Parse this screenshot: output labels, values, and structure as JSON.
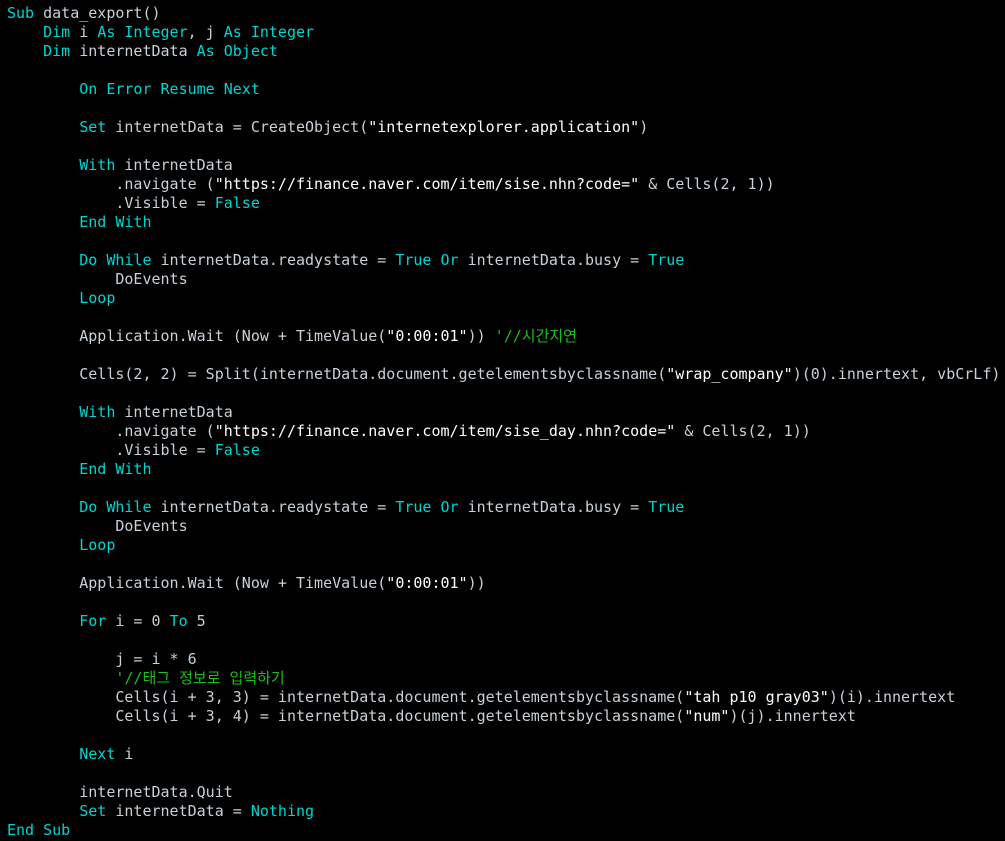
{
  "colors": {
    "background": "#000000",
    "keyword": "#00d4d4",
    "identifier": "#c8d0d8",
    "string": "#ffffff",
    "comment": "#19c019"
  },
  "lines": [
    [
      [
        "kw",
        "Sub "
      ],
      [
        "id",
        "data_export()"
      ]
    ],
    [
      [
        "kw",
        "    Dim "
      ],
      [
        "id",
        "i "
      ],
      [
        "kw",
        "As Integer"
      ],
      [
        "id",
        ", j "
      ],
      [
        "kw",
        "As Integer"
      ]
    ],
    [
      [
        "kw",
        "    Dim "
      ],
      [
        "id",
        "internetData "
      ],
      [
        "kw",
        "As Object"
      ]
    ],
    [],
    [
      [
        "kw",
        "        On Error Resume Next"
      ]
    ],
    [],
    [
      [
        "kw",
        "        Set "
      ],
      [
        "id",
        "internetData = CreateObject("
      ],
      [
        "str",
        "\"internetexplorer.application\""
      ],
      [
        "id",
        ")"
      ]
    ],
    [],
    [
      [
        "kw",
        "        With "
      ],
      [
        "id",
        "internetData"
      ]
    ],
    [
      [
        "id",
        "            .navigate ("
      ],
      [
        "str",
        "\"https://finance.naver.com/item/sise.nhn?code=\""
      ],
      [
        "id",
        " & Cells(2, 1))"
      ]
    ],
    [
      [
        "id",
        "            .Visible = "
      ],
      [
        "kw",
        "False"
      ]
    ],
    [
      [
        "kw",
        "        End With"
      ]
    ],
    [],
    [
      [
        "kw",
        "        Do While "
      ],
      [
        "id",
        "internetData.readystate = "
      ],
      [
        "kw",
        "True Or "
      ],
      [
        "id",
        "internetData.busy = "
      ],
      [
        "kw",
        "True"
      ]
    ],
    [
      [
        "id",
        "            DoEvents"
      ]
    ],
    [
      [
        "kw",
        "        Loop"
      ]
    ],
    [],
    [
      [
        "id",
        "        Application.Wait (Now + TimeValue("
      ],
      [
        "str",
        "\"0:00:01\""
      ],
      [
        "id",
        ")) "
      ],
      [
        "cm",
        "'//시간지연"
      ]
    ],
    [],
    [
      [
        "id",
        "        Cells(2, 2) = Split(internetData.document.getelementsbyclassname("
      ],
      [
        "str",
        "\"wrap_company\""
      ],
      [
        "id",
        ")(0).innertext, vbCrLf)"
      ]
    ],
    [],
    [
      [
        "kw",
        "        With "
      ],
      [
        "id",
        "internetData"
      ]
    ],
    [
      [
        "id",
        "            .navigate ("
      ],
      [
        "str",
        "\"https://finance.naver.com/item/sise_day.nhn?code=\""
      ],
      [
        "id",
        " & Cells(2, 1))"
      ]
    ],
    [
      [
        "id",
        "            .Visible = "
      ],
      [
        "kw",
        "False"
      ]
    ],
    [
      [
        "kw",
        "        End With"
      ]
    ],
    [],
    [
      [
        "kw",
        "        Do While "
      ],
      [
        "id",
        "internetData.readystate = "
      ],
      [
        "kw",
        "True Or "
      ],
      [
        "id",
        "internetData.busy = "
      ],
      [
        "kw",
        "True"
      ]
    ],
    [
      [
        "id",
        "            DoEvents"
      ]
    ],
    [
      [
        "kw",
        "        Loop"
      ]
    ],
    [],
    [
      [
        "id",
        "        Application.Wait (Now + TimeValue("
      ],
      [
        "str",
        "\"0:00:01\""
      ],
      [
        "id",
        "))"
      ]
    ],
    [],
    [
      [
        "kw",
        "        For "
      ],
      [
        "id",
        "i = 0 "
      ],
      [
        "kw",
        "To "
      ],
      [
        "id",
        "5"
      ]
    ],
    [],
    [
      [
        "id",
        "            j = i * 6"
      ]
    ],
    [
      [
        "cm",
        "            '//태그 정보로 입력하기"
      ]
    ],
    [
      [
        "id",
        "            Cells(i + 3, 3) = internetData.document.getelementsbyclassname("
      ],
      [
        "str",
        "\"tah p10 gray03\""
      ],
      [
        "id",
        ")(i).innertext"
      ]
    ],
    [
      [
        "id",
        "            Cells(i + 3, 4) = internetData.document.getelementsbyclassname("
      ],
      [
        "str",
        "\"num\""
      ],
      [
        "id",
        ")(j).innertext"
      ]
    ],
    [],
    [
      [
        "kw",
        "        Next "
      ],
      [
        "id",
        "i"
      ]
    ],
    [],
    [
      [
        "id",
        "        internetData.Quit"
      ]
    ],
    [
      [
        "kw",
        "        Set "
      ],
      [
        "id",
        "internetData = "
      ],
      [
        "kw",
        "Nothing"
      ]
    ],
    [
      [
        "kw",
        "End Sub"
      ]
    ]
  ]
}
